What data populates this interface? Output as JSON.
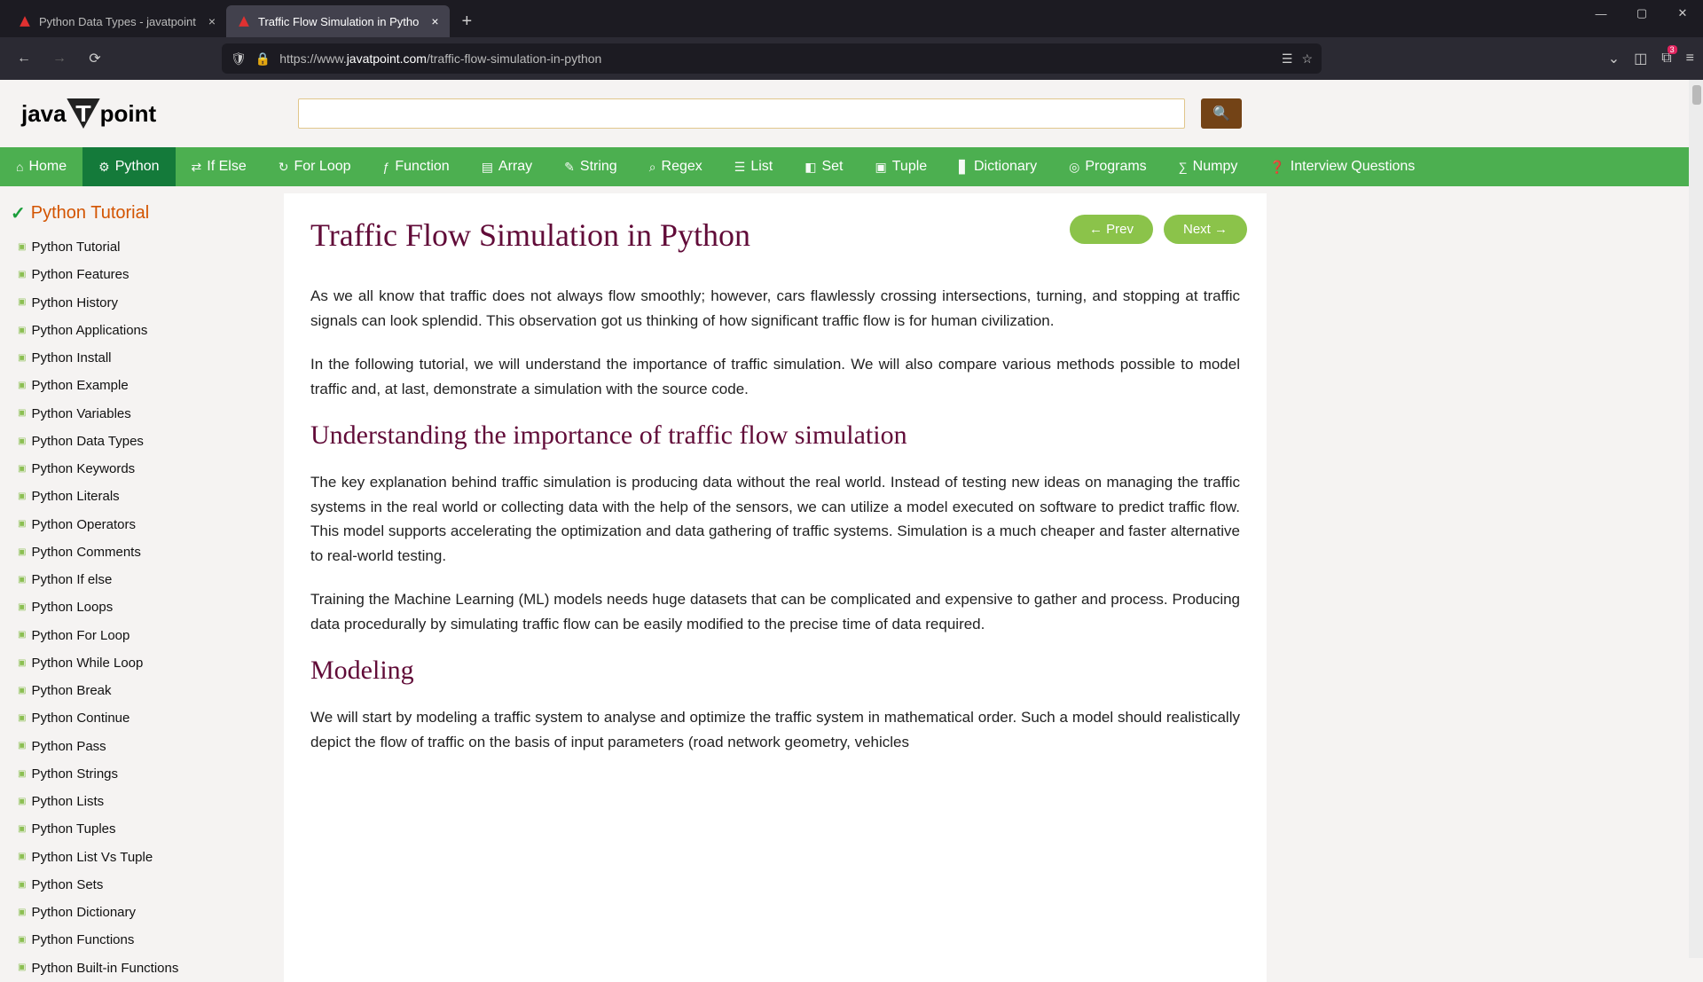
{
  "browser": {
    "tabs": [
      {
        "title": "Python Data Types - javatpoint",
        "active": false
      },
      {
        "title": "Traffic Flow Simulation in Pytho",
        "active": true
      }
    ],
    "url_prefix": "https://www.",
    "url_domain": "javatpoint.com",
    "url_path": "/traffic-flow-simulation-in-python",
    "ext_badge": "3"
  },
  "logo": {
    "a": "java",
    "b": "T",
    "c": "point"
  },
  "nav": [
    {
      "label": "Home",
      "icon": "⌂"
    },
    {
      "label": "Python",
      "icon": "⚙",
      "active": true
    },
    {
      "label": "If Else",
      "icon": "⇄"
    },
    {
      "label": "For Loop",
      "icon": "↻"
    },
    {
      "label": "Function",
      "icon": "ƒ"
    },
    {
      "label": "Array",
      "icon": "▤"
    },
    {
      "label": "String",
      "icon": "✎"
    },
    {
      "label": "Regex",
      "icon": "⌕"
    },
    {
      "label": "List",
      "icon": "☰"
    },
    {
      "label": "Set",
      "icon": "◧"
    },
    {
      "label": "Tuple",
      "icon": "▣"
    },
    {
      "label": "Dictionary",
      "icon": "▋"
    },
    {
      "label": "Programs",
      "icon": "◎"
    },
    {
      "label": "Numpy",
      "icon": "∑"
    },
    {
      "label": "Interview Questions",
      "icon": "❓"
    }
  ],
  "sidebar": {
    "section": "Python Tutorial",
    "items": [
      "Python Tutorial",
      "Python Features",
      "Python History",
      "Python Applications",
      "Python Install",
      "Python Example",
      "Python Variables",
      "Python Data Types",
      "Python Keywords",
      "Python Literals",
      "Python Operators",
      "Python Comments",
      "Python If else",
      "Python Loops",
      "Python For Loop",
      "Python While Loop",
      "Python Break",
      "Python Continue",
      "Python Pass",
      "Python Strings",
      "Python Lists",
      "Python Tuples",
      "Python List Vs Tuple",
      "Python Sets",
      "Python Dictionary",
      "Python Functions",
      "Python Built-in Functions"
    ]
  },
  "article": {
    "title": "Traffic Flow Simulation in Python",
    "prev": "← Prev",
    "next": "Next →",
    "p1": "As we all know that traffic does not always flow smoothly; however, cars flawlessly crossing intersections, turning, and stopping at traffic signals can look splendid. This observation got us thinking of how significant traffic flow is for human civilization.",
    "p2": "In the following tutorial, we will understand the importance of traffic simulation. We will also compare various methods possible to model traffic and, at last, demonstrate a simulation with the source code.",
    "h2a": "Understanding the importance of traffic flow simulation",
    "p3": "The key explanation behind traffic simulation is producing data without the real world. Instead of testing new ideas on managing the traffic systems in the real world or collecting data with the help of the sensors, we can utilize a model executed on software to predict traffic flow. This model supports accelerating the optimization and data gathering of traffic systems. Simulation is a much cheaper and faster alternative to real-world testing.",
    "p4": "Training the Machine Learning (ML) models needs huge datasets that can be complicated and expensive to gather and process. Producing data procedurally by simulating traffic flow can be easily modified to the precise time of data required.",
    "h2b": "Modeling",
    "p5": "We will start by modeling a traffic system to analyse and optimize the traffic system in mathematical order. Such a model should realistically depict the flow of traffic on the basis of input parameters (road network geometry, vehicles"
  }
}
